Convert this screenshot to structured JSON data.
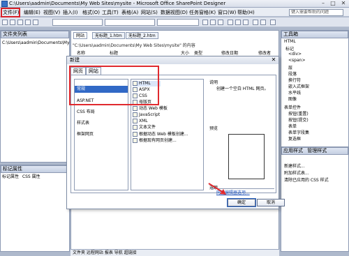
{
  "window": {
    "title": "C:\\Users\\aadmin\\Documents\\My Web Sites\\mysite - Microsoft Office SharePoint Designer",
    "minimize": "–",
    "maximize": "□",
    "close": "✕"
  },
  "menubar": {
    "items": [
      "文件(F)",
      "编辑(E)",
      "视图(V)",
      "插入(I)",
      "格式(O)",
      "工具(T)",
      "表格(A)",
      "网站(S)",
      "数据视图(D)",
      "任务窗格(K)",
      "窗口(W)",
      "帮助(H)"
    ],
    "help_search": "键入需要帮助的问题"
  },
  "left": {
    "folder_list_title": "文件夹列表",
    "folder_path": "C:\\Users\\aadmin\\Documents\\My",
    "tag_properties_title": "标记属性",
    "tag_tabs": [
      "标记属性",
      "CSS 属性"
    ]
  },
  "doc": {
    "tabs": [
      "网站",
      "无标题_1.htm",
      "无标题_2.htm"
    ],
    "path": "\"C:\\Users\\aadmin\\Documents\\My Web Sites\\mysite\" 的内容",
    "columns": [
      "名称",
      "标题",
      "大小",
      "类型",
      "修改日期",
      "修改者"
    ]
  },
  "status": {
    "text": "文件夹  远程网站  报表  导航  超链接"
  },
  "right": {
    "toolbox_title": "工具箱",
    "toolbox_items": [
      "HTML",
      "标记",
      "<div>",
      "<span>",
      "层",
      "段落",
      "换行符",
      "嵌入式框架",
      "水平线",
      "图像",
      "表单控件",
      "按钮(重置)",
      "按钮(提交)",
      "表单",
      "表单字段集",
      "复选框"
    ],
    "apply_styles_title": "应用样式",
    "manage_styles_title": "管理样式",
    "apply_items": [
      "新建样式...",
      "附加样式表...",
      "清除已应用的 CSS 样式"
    ]
  },
  "dialog": {
    "title": "新建",
    "close": "✕",
    "tabs": [
      "网页",
      "网站"
    ],
    "categories": [
      "常规",
      "ASP.NET",
      "CSS 布局",
      "样式表",
      "框架网页"
    ],
    "templates": [
      "HTML",
      "ASPX",
      "CSS",
      "母版页",
      "动态 Web 模板",
      "JavaScript",
      "XML",
      "文本文件",
      "根据动态 Web 模板创建...",
      "根据现有网页创建..."
    ],
    "description_label": "说明",
    "description_text": "创建一个空白 HTML 网页。",
    "preview_label": "预览",
    "options_label": "选项",
    "options_link": "网页编辑器选项...",
    "ok": "确定",
    "cancel": "取消"
  },
  "colors": {
    "highlight_red": "#e0292e",
    "selection_blue": "#3169c6"
  }
}
